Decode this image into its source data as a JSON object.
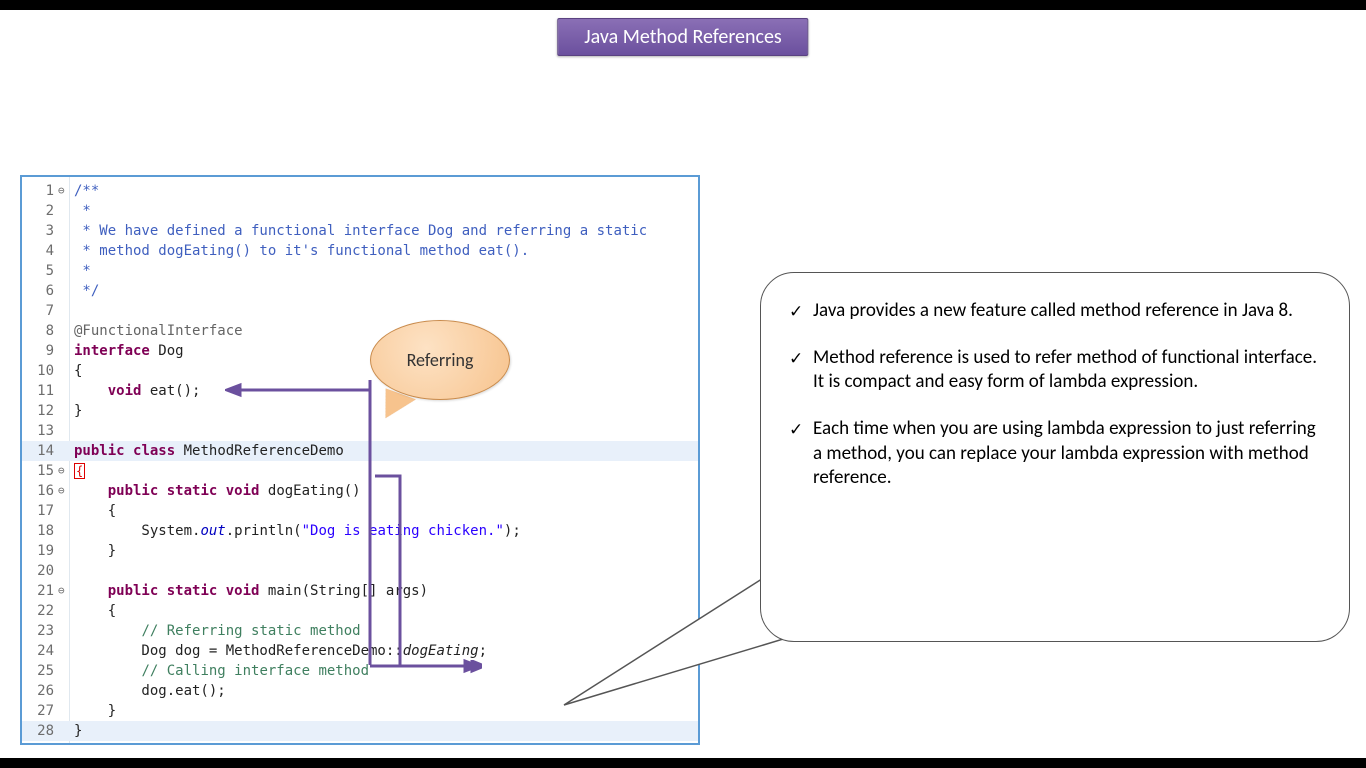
{
  "title": "Java Method References",
  "callout_label": "Referring",
  "code": {
    "lines": [
      {
        "n": 1,
        "fold": "⊖",
        "segs": [
          {
            "t": "/**",
            "c": "jd"
          }
        ]
      },
      {
        "n": 2,
        "segs": [
          {
            "t": " *",
            "c": "jd"
          }
        ]
      },
      {
        "n": 3,
        "segs": [
          {
            "t": " * We have defined a functional interface Dog and referring a static",
            "c": "jd"
          }
        ]
      },
      {
        "n": 4,
        "segs": [
          {
            "t": " * method dogEating() to it's functional method eat().",
            "c": "jd"
          }
        ]
      },
      {
        "n": 5,
        "segs": [
          {
            "t": " *",
            "c": "jd"
          }
        ]
      },
      {
        "n": 6,
        "segs": [
          {
            "t": " */",
            "c": "jd"
          }
        ]
      },
      {
        "n": 7,
        "segs": [
          {
            "t": ""
          }
        ]
      },
      {
        "n": 8,
        "segs": [
          {
            "t": "@FunctionalInterface",
            "c": "ann"
          }
        ]
      },
      {
        "n": 9,
        "segs": [
          {
            "t": "interface",
            "c": "kw"
          },
          {
            "t": " Dog"
          }
        ]
      },
      {
        "n": 10,
        "segs": [
          {
            "t": "{"
          }
        ]
      },
      {
        "n": 11,
        "segs": [
          {
            "t": "    "
          },
          {
            "t": "void",
            "c": "kw"
          },
          {
            "t": " eat();"
          }
        ]
      },
      {
        "n": 12,
        "segs": [
          {
            "t": "}"
          }
        ]
      },
      {
        "n": 13,
        "segs": [
          {
            "t": ""
          }
        ]
      },
      {
        "n": 14,
        "hl": true,
        "segs": [
          {
            "t": "public",
            "c": "kw"
          },
          {
            "t": " "
          },
          {
            "t": "class",
            "c": "kw"
          },
          {
            "t": " MethodReferenceDemo"
          }
        ]
      },
      {
        "n": 15,
        "fold": "⊖",
        "segs": [
          {
            "t": "{",
            "err": true
          }
        ]
      },
      {
        "n": 16,
        "fold": "⊖",
        "segs": [
          {
            "t": "    "
          },
          {
            "t": "public",
            "c": "kw"
          },
          {
            "t": " "
          },
          {
            "t": "static",
            "c": "kw"
          },
          {
            "t": " "
          },
          {
            "t": "void",
            "c": "kw"
          },
          {
            "t": " dogEating()"
          }
        ]
      },
      {
        "n": 17,
        "segs": [
          {
            "t": "    {"
          }
        ]
      },
      {
        "n": 18,
        "segs": [
          {
            "t": "        System."
          },
          {
            "t": "out",
            "c": "fld"
          },
          {
            "t": ".println("
          },
          {
            "t": "\"Dog is eating chicken.\"",
            "c": "str"
          },
          {
            "t": ");"
          }
        ]
      },
      {
        "n": 19,
        "segs": [
          {
            "t": "    }"
          }
        ]
      },
      {
        "n": 20,
        "segs": [
          {
            "t": ""
          }
        ]
      },
      {
        "n": 21,
        "fold": "⊖",
        "segs": [
          {
            "t": "    "
          },
          {
            "t": "public",
            "c": "kw"
          },
          {
            "t": " "
          },
          {
            "t": "static",
            "c": "kw"
          },
          {
            "t": " "
          },
          {
            "t": "void",
            "c": "kw"
          },
          {
            "t": " main(String[] args)"
          }
        ]
      },
      {
        "n": 22,
        "segs": [
          {
            "t": "    {"
          }
        ]
      },
      {
        "n": 23,
        "segs": [
          {
            "t": "        "
          },
          {
            "t": "// Referring static method",
            "c": "cm"
          }
        ]
      },
      {
        "n": 24,
        "segs": [
          {
            "t": "        Dog dog = MethodReferenceDemo::"
          },
          {
            "t": "dogEating",
            "c": "it"
          },
          {
            "t": ";"
          }
        ]
      },
      {
        "n": 25,
        "segs": [
          {
            "t": "        "
          },
          {
            "t": "// Calling interface method",
            "c": "cm"
          }
        ]
      },
      {
        "n": 26,
        "segs": [
          {
            "t": "        dog.eat();"
          }
        ]
      },
      {
        "n": 27,
        "segs": [
          {
            "t": "    }"
          }
        ]
      },
      {
        "n": 28,
        "hl": true,
        "segs": [
          {
            "t": "}"
          }
        ]
      }
    ]
  },
  "bullets": [
    "Java provides a new feature called method reference in Java 8.",
    "Method reference is used to refer method of functional interface. It is compact and easy form of lambda expression.",
    "Each time when you are using lambda expression to just referring a method, you can replace your lambda expression with method reference."
  ]
}
